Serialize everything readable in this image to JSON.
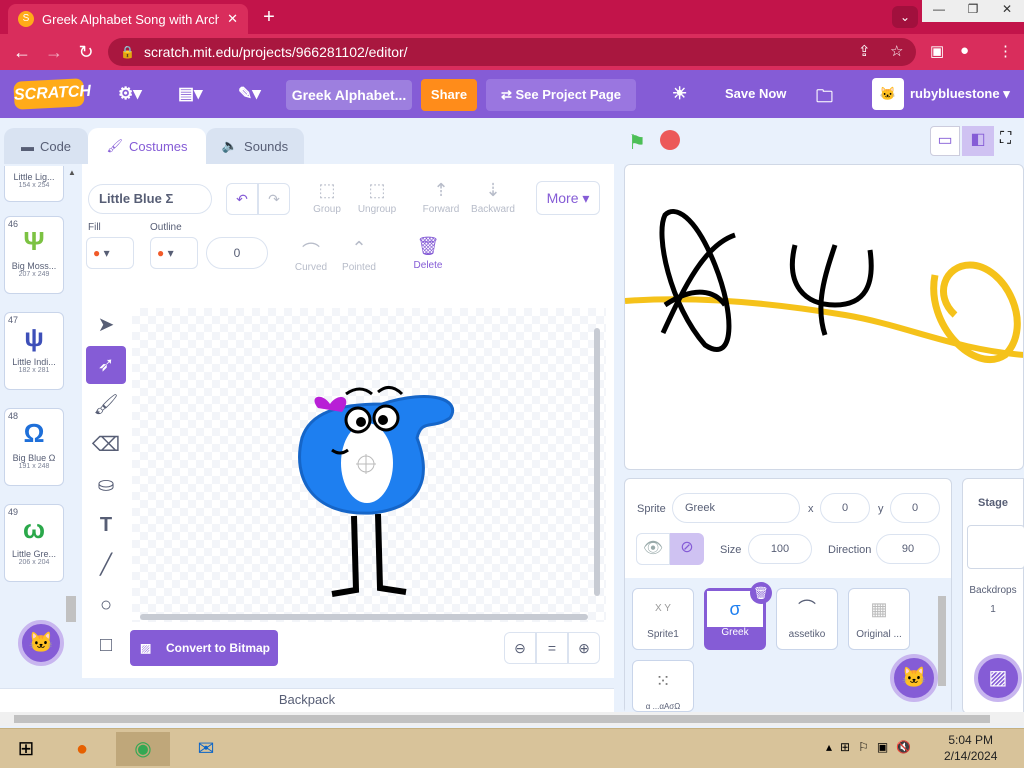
{
  "browser": {
    "tab_title": "Greek Alphabet Song with Archa",
    "tab_favicon": "S",
    "url": "scratch.mit.edu/projects/966281102/editor/",
    "win_min": "—",
    "win_restore": "❐",
    "win_close": "✕"
  },
  "menubar": {
    "logo": "SCRATCH",
    "project_title": "Greek Alphabet...",
    "share": "Share",
    "see_project_page": "See Project Page",
    "save_now": "Save Now",
    "username": "rubybluestone"
  },
  "editor_tabs": {
    "code": "Code",
    "costumes": "Costumes",
    "sounds": "Sounds"
  },
  "costumes": [
    {
      "num": "",
      "name": "Little Lig...",
      "size": "154 x 254",
      "glyph": "",
      "color": "#1a8c3a"
    },
    {
      "num": "46",
      "name": "Big Moss...",
      "size": "207 x 249",
      "glyph": "Ψ",
      "color": "#7cc242"
    },
    {
      "num": "47",
      "name": "Little Indi...",
      "size": "182 x 281",
      "glyph": "ψ",
      "color": "#3d4fb8"
    },
    {
      "num": "48",
      "name": "Big Blue Ω",
      "size": "191 x 248",
      "glyph": "Ω",
      "color": "#1e6fd9"
    },
    {
      "num": "49",
      "name": "Little Gre...",
      "size": "206 x 204",
      "glyph": "ω",
      "color": "#2aa84a"
    }
  ],
  "paint": {
    "costume_name": "Little Blue Σ",
    "group": "Group",
    "ungroup": "Ungroup",
    "forward": "Forward",
    "backward": "Backward",
    "more": "More",
    "fill_label": "Fill",
    "outline_label": "Outline",
    "stroke_width": "0",
    "curved": "Curved",
    "pointed": "Pointed",
    "delete": "Delete",
    "convert": "Convert to Bitmap",
    "zoom_reset": "="
  },
  "backpack": "Backpack",
  "sprite_info": {
    "sprite_label": "Sprite",
    "sprite_name": "Greek",
    "x_label": "x",
    "x": "0",
    "y_label": "y",
    "y": "0",
    "size_label": "Size",
    "size": "100",
    "direction_label": "Direction",
    "direction": "90"
  },
  "sprites": [
    {
      "name": "Sprite1",
      "thumb": "X Y"
    },
    {
      "name": "Greek",
      "thumb": "σ"
    },
    {
      "name": "assetiko",
      "thumb": "⌒"
    },
    {
      "name": "Original ...",
      "thumb": "▦"
    },
    {
      "name": "α ...αAσΩ",
      "thumb": "⁙"
    }
  ],
  "stage_panel": {
    "title": "Stage",
    "backdrops_label": "Backdrops",
    "backdrops_count": "1"
  },
  "taskbar": {
    "time": "5:04 PM",
    "date": "2/14/2024"
  },
  "colors": {
    "scratch_purple": "#855cd6",
    "share_orange": "#ff8c1a",
    "chrome_pink": "#d92d5c",
    "sprite_blue": "#1e7ff0"
  }
}
